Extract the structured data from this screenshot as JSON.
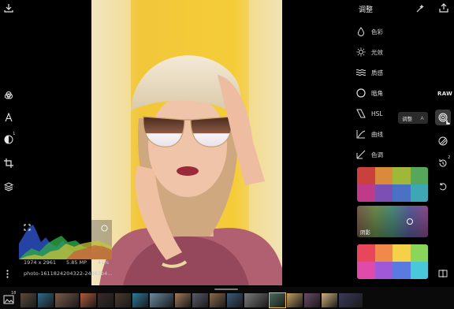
{
  "panel": {
    "title": "调整",
    "items": [
      {
        "label": "色彩",
        "icon": "drop-icon"
      },
      {
        "label": "光效",
        "icon": "sun-icon"
      },
      {
        "label": "质感",
        "icon": "waves-icon"
      },
      {
        "label": "暗角",
        "icon": "vignette-icon"
      },
      {
        "label": "HSL",
        "icon": "hsl-icon"
      },
      {
        "label": "曲线",
        "icon": "curve-icon"
      },
      {
        "label": "色调",
        "icon": "split-tone-icon"
      }
    ],
    "raw_label": "RAW",
    "tooltip": {
      "label": "调整",
      "key": "A"
    },
    "badge_count": "2",
    "preset_card_label": "阴影",
    "swatch_colors": {
      "card1_top": [
        "#c9403c",
        "#d98a3a",
        "#9fb83a",
        "#55a85a"
      ],
      "card1_bottom": [
        "#c03a8a",
        "#7c4fb5",
        "#4a72c4",
        "#3ea7b4"
      ],
      "card3_top": [
        "#e8465a",
        "#f08a4a",
        "#f3d24a",
        "#8ad65a"
      ],
      "card3_bottom": [
        "#e04aa8",
        "#a058d8",
        "#5a7ae0",
        "#48c8d8"
      ]
    }
  },
  "left_tools": [
    "layers-overlap-icon",
    "text-icon",
    "face-icon",
    "crop-icon",
    "stack-icon"
  ],
  "left_badge": "1",
  "histogram": {
    "dimensions": "1974 x 2961",
    "megapixels": "5.85 MP",
    "zoom": "41%"
  },
  "filename": "photo-1611824204322-24963b4...",
  "filmstrip": {
    "badge": "18",
    "thumb_colors": [
      "#5a4a3a",
      "#2e6a8a",
      "#7a5a4a",
      "#b05a3a",
      "#3a2a2a",
      "#4a3a2a",
      "#2a7a9a",
      "#6a8aa0",
      "#a07a5a",
      "#5a5a6a",
      "#8a6a4a",
      "#3a5a7a",
      "#7a7a7a",
      "#4a6a5a",
      "#c0a060",
      "#6a4a6a",
      "#d0b080",
      "#3a3a5a"
    ]
  }
}
